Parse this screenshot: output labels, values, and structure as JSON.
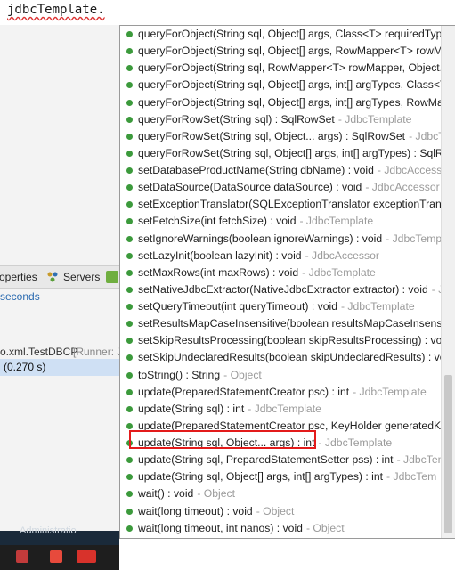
{
  "editor": {
    "code_text": "jdbcTemplate."
  },
  "background_views": {
    "properties_tab": "operties",
    "servers_tab": "Servers",
    "seconds_text": "seconds",
    "console_run_name": "o.xml.TestDBCP",
    "console_run_meta": "[Runner: J",
    "console_selected": "(0.270 s)",
    "taskbar_label": "Administratio"
  },
  "completion_items": [
    {
      "sig": "queryForObject(String sql, Object[] args, Class<T> requiredType)",
      "decl": ""
    },
    {
      "sig": "queryForObject(String sql, Object[] args, RowMapper<T> rowMa",
      "decl": ""
    },
    {
      "sig": "queryForObject(String sql, RowMapper<T> rowMapper, Object...",
      "decl": ""
    },
    {
      "sig": "queryForObject(String sql, Object[] args, int[] argTypes, Class<T>",
      "decl": ""
    },
    {
      "sig": "queryForObject(String sql, Object[] args, int[] argTypes, RowMapp",
      "decl": ""
    },
    {
      "sig": "queryForRowSet(String sql) : SqlRowSet",
      "decl": "- JdbcTemplate"
    },
    {
      "sig": "queryForRowSet(String sql, Object... args) : SqlRowSet",
      "decl": "- JdbcTemp"
    },
    {
      "sig": "queryForRowSet(String sql, Object[] args, int[] argTypes) : SqlRow",
      "decl": ""
    },
    {
      "sig": "setDatabaseProductName(String dbName) : void",
      "decl": "- JdbcAccessor"
    },
    {
      "sig": "setDataSource(DataSource dataSource) : void",
      "decl": "- JdbcAccessor"
    },
    {
      "sig": "setExceptionTranslator(SQLExceptionTranslator exceptionTranslat",
      "decl": ""
    },
    {
      "sig": "setFetchSize(int fetchSize) : void",
      "decl": "- JdbcTemplate"
    },
    {
      "sig": "setIgnoreWarnings(boolean ignoreWarnings) : void",
      "decl": "- JdbcTemplat"
    },
    {
      "sig": "setLazyInit(boolean lazyInit) : void",
      "decl": "- JdbcAccessor"
    },
    {
      "sig": "setMaxRows(int maxRows) : void",
      "decl": "- JdbcTemplate"
    },
    {
      "sig": "setNativeJdbcExtractor(NativeJdbcExtractor extractor) : void",
      "decl": "- Jdb"
    },
    {
      "sig": "setQueryTimeout(int queryTimeout) : void",
      "decl": "- JdbcTemplate"
    },
    {
      "sig": "setResultsMapCaseInsensitive(boolean resultsMapCaseInsensitive",
      "decl": ""
    },
    {
      "sig": "setSkipResultsProcessing(boolean skipResultsProcessing) : void",
      "decl": "- Jd"
    },
    {
      "sig": "setSkipUndeclaredResults(boolean skipUndeclaredResults) : void",
      "decl": ""
    },
    {
      "sig": "toString() : String",
      "decl": "- Object"
    },
    {
      "sig": "update(PreparedStatementCreator psc) : int",
      "decl": "- JdbcTemplate"
    },
    {
      "sig": "update(String sql) : int",
      "decl": "- JdbcTemplate"
    },
    {
      "sig": "update(PreparedStatementCreator psc, KeyHolder generatedKeyH",
      "decl": ""
    },
    {
      "sig": "update(String sql, Object... args) : int",
      "decl": "- JdbcTemplate"
    },
    {
      "sig": "update(String sql, PreparedStatementSetter pss) : int",
      "decl": "- JdbcTempla"
    },
    {
      "sig": "update(String sql, Object[] args, int[] argTypes) : int",
      "decl": "- JdbcTem"
    },
    {
      "sig": "wait() : void",
      "decl": "- Object"
    },
    {
      "sig": "wait(long timeout) : void",
      "decl": "- Object"
    },
    {
      "sig": "wait(long timeout, int nanos) : void",
      "decl": "- Object"
    }
  ],
  "colors": {
    "method_dot": "#3c9a3c",
    "highlight_box": "#e31b1b",
    "declaring_type": "#9b9b9b"
  },
  "icons": [
    "public-method-icon",
    "servers-icon"
  ]
}
